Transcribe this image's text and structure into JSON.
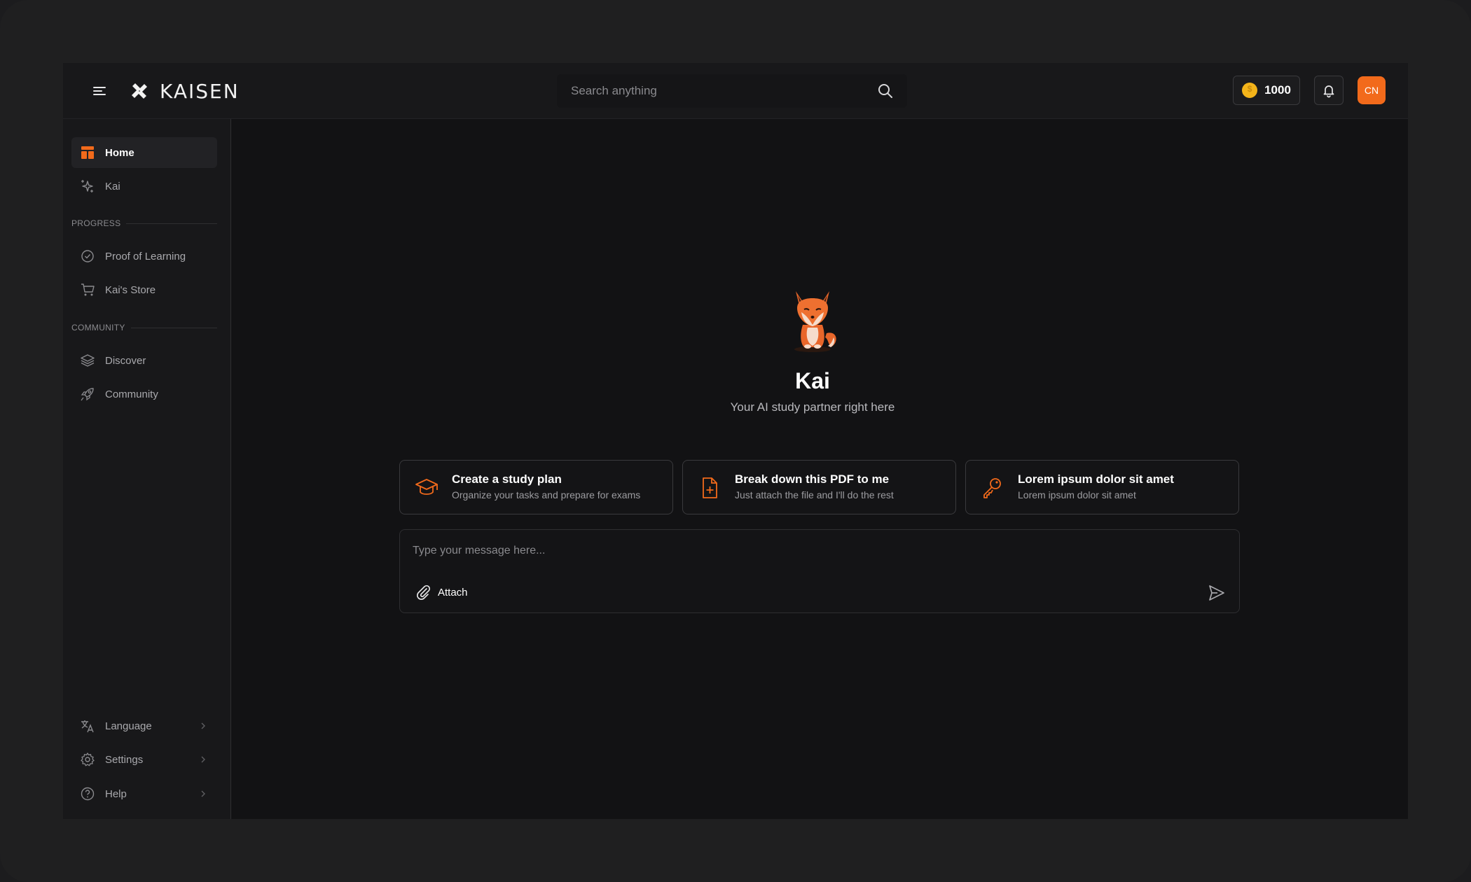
{
  "brand": {
    "name": "KAISEN"
  },
  "search": {
    "placeholder": "Search anything"
  },
  "header": {
    "coins": "1000",
    "avatar_initials": "CN"
  },
  "sidebar": {
    "items": [
      {
        "label": "Home",
        "icon": "layout-icon",
        "active": true
      },
      {
        "label": "Kai",
        "icon": "sparkles-icon"
      }
    ],
    "progress_label": "PROGRESS",
    "progress_items": [
      {
        "label": "Proof of Learning",
        "icon": "check-circle-icon"
      },
      {
        "label": "Kai's Store",
        "icon": "cart-icon"
      }
    ],
    "community_label": "COMMUNITY",
    "community_items": [
      {
        "label": "Discover",
        "icon": "layers-icon"
      },
      {
        "label": "Community",
        "icon": "rocket-icon"
      }
    ],
    "bottom_items": [
      {
        "label": "Language",
        "icon": "translate-icon"
      },
      {
        "label": "Settings",
        "icon": "gear-icon"
      },
      {
        "label": "Help",
        "icon": "help-icon"
      }
    ]
  },
  "main": {
    "title": "Kai",
    "subtitle": "Your AI study partner right here",
    "cards": [
      {
        "title": "Create a study plan",
        "desc": "Organize your tasks and prepare for exams",
        "icon": "graduation-cap-icon"
      },
      {
        "title": "Break down this PDF to me",
        "desc": "Just attach the file and I'll do the rest",
        "icon": "file-plus-icon"
      },
      {
        "title": "Lorem ipsum dolor sit amet",
        "desc": "Lorem ipsum dolor sit amet",
        "icon": "key-icon"
      }
    ],
    "composer": {
      "placeholder": "Type your message here...",
      "attach_label": "Attach"
    }
  },
  "colors": {
    "accent": "#f26a1b",
    "background": "#121214",
    "coin": "#f4b41a"
  }
}
